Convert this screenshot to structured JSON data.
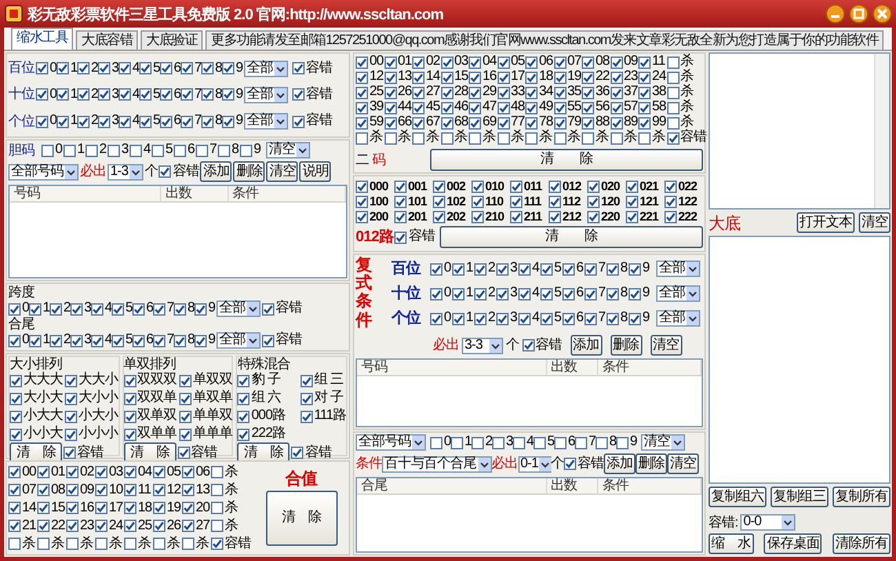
{
  "window": {
    "title": "彩无敌彩票软件三星工具免费版 2.0 官网:http://www.sscltan.com"
  },
  "tabs": [
    {
      "label": "缩水工具",
      "selected": true
    },
    {
      "label": "大底容错",
      "selected": false
    },
    {
      "label": "大底验证",
      "selected": false
    },
    {
      "label": "更多功能请发至邮箱1257251000@qq.com感谢我们官网www.sscltan.com发来文章彩无敌全新为您打造属于你的功能软件",
      "selected": false
    }
  ],
  "left": {
    "positions": [
      {
        "label": "百位",
        "digits": [
          {
            "label": "0",
            "checked": true
          },
          {
            "label": "1",
            "checked": true
          },
          {
            "label": "2",
            "checked": true
          },
          {
            "label": "3",
            "checked": true
          },
          {
            "label": "4",
            "checked": true
          },
          {
            "label": "5",
            "checked": true
          },
          {
            "label": "6",
            "checked": true
          },
          {
            "label": "7",
            "checked": true
          },
          {
            "label": "8",
            "checked": true
          },
          {
            "label": "9",
            "checked": true
          }
        ],
        "select": "全部",
        "tolerance": {
          "label": "容错",
          "checked": true
        }
      },
      {
        "label": "十位",
        "digits": [
          {
            "label": "0",
            "checked": true
          },
          {
            "label": "1",
            "checked": true
          },
          {
            "label": "2",
            "checked": true
          },
          {
            "label": "3",
            "checked": true
          },
          {
            "label": "4",
            "checked": true
          },
          {
            "label": "5",
            "checked": true
          },
          {
            "label": "6",
            "checked": true
          },
          {
            "label": "7",
            "checked": true
          },
          {
            "label": "8",
            "checked": true
          },
          {
            "label": "9",
            "checked": true
          }
        ],
        "select": "全部",
        "tolerance": {
          "label": "容错",
          "checked": true
        }
      },
      {
        "label": "个位",
        "digits": [
          {
            "label": "0",
            "checked": true
          },
          {
            "label": "1",
            "checked": true
          },
          {
            "label": "2",
            "checked": true
          },
          {
            "label": "3",
            "checked": true
          },
          {
            "label": "4",
            "checked": true
          },
          {
            "label": "5",
            "checked": true
          },
          {
            "label": "6",
            "checked": true
          },
          {
            "label": "7",
            "checked": true
          },
          {
            "label": "8",
            "checked": true
          },
          {
            "label": "9",
            "checked": true
          }
        ],
        "select": "全部",
        "tolerance": {
          "label": "容错",
          "checked": true
        }
      }
    ],
    "dan": {
      "label": "胆码",
      "digits": [
        {
          "label": "0",
          "checked": false
        },
        {
          "label": "1",
          "checked": false
        },
        {
          "label": "2",
          "checked": false
        },
        {
          "label": "3",
          "checked": false
        },
        {
          "label": "4",
          "checked": false
        },
        {
          "label": "5",
          "checked": false
        },
        {
          "label": "6",
          "checked": false
        },
        {
          "label": "7",
          "checked": false
        },
        {
          "label": "8",
          "checked": false
        },
        {
          "label": "9",
          "checked": false
        }
      ],
      "select": "清空"
    },
    "dan_filter": {
      "select": "全部号码",
      "must_label": "必出",
      "must_select": "1-3",
      "unit": "个",
      "tolerance": {
        "label": "容错",
        "checked": true
      },
      "buttons": [
        "添加",
        "删除",
        "清空",
        "说明"
      ]
    },
    "dan_list": {
      "columns": [
        "号码",
        "出数",
        "条件"
      ]
    },
    "span": {
      "label": "跨度",
      "digits": [
        {
          "label": "0",
          "checked": true
        },
        {
          "label": "1",
          "checked": true
        },
        {
          "label": "2",
          "checked": true
        },
        {
          "label": "3",
          "checked": true
        },
        {
          "label": "4",
          "checked": true
        },
        {
          "label": "5",
          "checked": true
        },
        {
          "label": "6",
          "checked": true
        },
        {
          "label": "7",
          "checked": true
        },
        {
          "label": "8",
          "checked": true
        },
        {
          "label": "9",
          "checked": true
        }
      ],
      "select": "全部",
      "tolerance": {
        "label": "容错",
        "checked": true
      }
    },
    "sum_tail": {
      "label": "合尾",
      "digits": [
        {
          "label": "0",
          "checked": true
        },
        {
          "label": "1",
          "checked": true
        },
        {
          "label": "2",
          "checked": true
        },
        {
          "label": "3",
          "checked": true
        },
        {
          "label": "4",
          "checked": true
        },
        {
          "label": "5",
          "checked": true
        },
        {
          "label": "6",
          "checked": true
        },
        {
          "label": "7",
          "checked": true
        },
        {
          "label": "8",
          "checked": true
        },
        {
          "label": "9",
          "checked": true
        }
      ],
      "select": "全部",
      "tolerance": {
        "label": "容错",
        "checked": true
      }
    },
    "groups": [
      {
        "title": "大小排列",
        "items": [
          {
            "label": "大大大",
            "checked": true
          },
          {
            "label": "大大小",
            "checked": true
          },
          {
            "label": "大小大",
            "checked": true
          },
          {
            "label": "大小小",
            "checked": true
          },
          {
            "label": "小大大",
            "checked": true
          },
          {
            "label": "小大小",
            "checked": true
          },
          {
            "label": "小小大",
            "checked": true
          },
          {
            "label": "小小小",
            "checked": true
          }
        ],
        "button": "清　除",
        "tolerance": {
          "label": "容错",
          "checked": true
        }
      },
      {
        "title": "单双排列",
        "items": [
          {
            "label": "双双双",
            "checked": true
          },
          {
            "label": "单双双",
            "checked": true
          },
          {
            "label": "双双单",
            "checked": true
          },
          {
            "label": "单双单",
            "checked": true
          },
          {
            "label": "双单双",
            "checked": true
          },
          {
            "label": "单单双",
            "checked": true
          },
          {
            "label": "双单单",
            "checked": true
          },
          {
            "label": "单单单",
            "checked": true
          }
        ],
        "button": "清　除",
        "tolerance": {
          "label": "容错",
          "checked": true
        }
      },
      {
        "title": "特殊混合",
        "items": [
          {
            "label": "豹 子",
            "checked": true
          },
          {
            "label": "组 三",
            "checked": true
          },
          {
            "label": "组 六",
            "checked": true
          },
          {
            "label": "对 子",
            "checked": true
          },
          {
            "label": "000路",
            "checked": true
          },
          {
            "label": "111路",
            "checked": true
          },
          {
            "label": "222路",
            "checked": true
          }
        ],
        "button": "清　除",
        "tolerance": {
          "label": "容错",
          "checked": true
        }
      }
    ],
    "sums": {
      "rows": [
        {
          "items": [
            {
              "label": "00",
              "checked": true
            },
            {
              "label": "01",
              "checked": true
            },
            {
              "label": "02",
              "checked": true
            },
            {
              "label": "03",
              "checked": true
            },
            {
              "label": "04",
              "checked": true
            },
            {
              "label": "05",
              "checked": true
            },
            {
              "label": "06",
              "checked": true
            }
          ],
          "kill": {
            "label": "杀",
            "checked": false
          }
        },
        {
          "items": [
            {
              "label": "07",
              "checked": true
            },
            {
              "label": "08",
              "checked": true
            },
            {
              "label": "09",
              "checked": true
            },
            {
              "label": "10",
              "checked": true
            },
            {
              "label": "11",
              "checked": true
            },
            {
              "label": "12",
              "checked": true
            },
            {
              "label": "13",
              "checked": true
            }
          ],
          "kill": {
            "label": "杀",
            "checked": false
          }
        },
        {
          "items": [
            {
              "label": "14",
              "checked": true
            },
            {
              "label": "15",
              "checked": true
            },
            {
              "label": "16",
              "checked": true
            },
            {
              "label": "17",
              "checked": true
            },
            {
              "label": "18",
              "checked": true
            },
            {
              "label": "19",
              "checked": true
            },
            {
              "label": "20",
              "checked": true
            }
          ],
          "kill": {
            "label": "杀",
            "checked": false
          }
        },
        {
          "items": [
            {
              "label": "21",
              "checked": true
            },
            {
              "label": "22",
              "checked": true
            },
            {
              "label": "23",
              "checked": true
            },
            {
              "label": "24",
              "checked": true
            },
            {
              "label": "25",
              "checked": true
            },
            {
              "label": "26",
              "checked": true
            },
            {
              "label": "27",
              "checked": true
            }
          ],
          "kill": {
            "label": "杀",
            "checked": false
          }
        }
      ],
      "kills": [
        {
          "label": "杀",
          "checked": false
        },
        {
          "label": "杀",
          "checked": false
        },
        {
          "label": "杀",
          "checked": false
        },
        {
          "label": "杀",
          "checked": false
        },
        {
          "label": "杀",
          "checked": false
        },
        {
          "label": "杀",
          "checked": false
        },
        {
          "label": "杀",
          "checked": false
        }
      ],
      "tolerance": {
        "label": "容错",
        "checked": true
      },
      "title": "合值",
      "button": "清　除"
    }
  },
  "middle": {
    "pairs": {
      "rows": [
        {
          "items": [
            {
              "label": "00",
              "checked": true
            },
            {
              "label": "01",
              "checked": true
            },
            {
              "label": "02",
              "checked": true
            },
            {
              "label": "03",
              "checked": true
            },
            {
              "label": "04",
              "checked": true
            },
            {
              "label": "05",
              "checked": true
            },
            {
              "label": "06",
              "checked": true
            },
            {
              "label": "07",
              "checked": true
            },
            {
              "label": "08",
              "checked": true
            },
            {
              "label": "09",
              "checked": true
            },
            {
              "label": "11",
              "checked": true
            }
          ],
          "kill": {
            "label": "杀",
            "checked": false
          }
        },
        {
          "items": [
            {
              "label": "12",
              "checked": true
            },
            {
              "label": "13",
              "checked": true
            },
            {
              "label": "14",
              "checked": true
            },
            {
              "label": "15",
              "checked": true
            },
            {
              "label": "16",
              "checked": true
            },
            {
              "label": "17",
              "checked": true
            },
            {
              "label": "18",
              "checked": true
            },
            {
              "label": "19",
              "checked": true
            },
            {
              "label": "22",
              "checked": true
            },
            {
              "label": "23",
              "checked": true
            },
            {
              "label": "24",
              "checked": true
            }
          ],
          "kill": {
            "label": "杀",
            "checked": false
          }
        },
        {
          "items": [
            {
              "label": "25",
              "checked": true
            },
            {
              "label": "26",
              "checked": true
            },
            {
              "label": "27",
              "checked": true
            },
            {
              "label": "28",
              "checked": true
            },
            {
              "label": "29",
              "checked": true
            },
            {
              "label": "33",
              "checked": true
            },
            {
              "label": "34",
              "checked": true
            },
            {
              "label": "35",
              "checked": true
            },
            {
              "label": "36",
              "checked": true
            },
            {
              "label": "37",
              "checked": true
            },
            {
              "label": "38",
              "checked": true
            }
          ],
          "kill": {
            "label": "杀",
            "checked": false
          }
        },
        {
          "items": [
            {
              "label": "39",
              "checked": true
            },
            {
              "label": "44",
              "checked": true
            },
            {
              "label": "45",
              "checked": true
            },
            {
              "label": "46",
              "checked": true
            },
            {
              "label": "47",
              "checked": true
            },
            {
              "label": "48",
              "checked": true
            },
            {
              "label": "49",
              "checked": true
            },
            {
              "label": "55",
              "checked": true
            },
            {
              "label": "56",
              "checked": true
            },
            {
              "label": "57",
              "checked": true
            },
            {
              "label": "58",
              "checked": true
            }
          ],
          "kill": {
            "label": "杀",
            "checked": false
          }
        },
        {
          "items": [
            {
              "label": "59",
              "checked": true
            },
            {
              "label": "66",
              "checked": true
            },
            {
              "label": "67",
              "checked": true
            },
            {
              "label": "68",
              "checked": true
            },
            {
              "label": "69",
              "checked": true
            },
            {
              "label": "77",
              "checked": true
            },
            {
              "label": "78",
              "checked": true
            },
            {
              "label": "79",
              "checked": true
            },
            {
              "label": "88",
              "checked": true
            },
            {
              "label": "89",
              "checked": true
            },
            {
              "label": "99",
              "checked": true
            }
          ],
          "kill": {
            "label": "杀",
            "checked": false
          }
        }
      ],
      "kills": [
        {
          "label": "杀",
          "checked": false
        },
        {
          "label": "杀",
          "checked": false
        },
        {
          "label": "杀",
          "checked": false
        },
        {
          "label": "杀",
          "checked": false
        },
        {
          "label": "杀",
          "checked": false
        },
        {
          "label": "杀",
          "checked": false
        },
        {
          "label": "杀",
          "checked": false
        },
        {
          "label": "杀",
          "checked": false
        },
        {
          "label": "杀",
          "checked": false
        },
        {
          "label": "杀",
          "checked": false
        },
        {
          "label": "杀",
          "checked": false
        }
      ],
      "tolerance": {
        "label": "容错",
        "checked": true
      },
      "title_parts": [
        {
          "text": "二",
          "color": "#000000"
        },
        {
          "text": "码",
          "color": "#e00000"
        }
      ],
      "button": "清　　除"
    },
    "route012": {
      "items": [
        {
          "label": "000",
          "checked": true
        },
        {
          "label": "001",
          "checked": true
        },
        {
          "label": "002",
          "checked": true
        },
        {
          "label": "010",
          "checked": true
        },
        {
          "label": "011",
          "checked": true
        },
        {
          "label": "012",
          "checked": true
        },
        {
          "label": "020",
          "checked": true
        },
        {
          "label": "021",
          "checked": true
        },
        {
          "label": "022",
          "checked": true
        },
        {
          "label": "100",
          "checked": true
        },
        {
          "label": "101",
          "checked": true
        },
        {
          "label": "102",
          "checked": true
        },
        {
          "label": "110",
          "checked": true
        },
        {
          "label": "111",
          "checked": true
        },
        {
          "label": "112",
          "checked": true
        },
        {
          "label": "120",
          "checked": true
        },
        {
          "label": "121",
          "checked": true
        },
        {
          "label": "122",
          "checked": true
        },
        {
          "label": "200",
          "checked": true
        },
        {
          "label": "201",
          "checked": true
        },
        {
          "label": "202",
          "checked": true
        },
        {
          "label": "210",
          "checked": true
        },
        {
          "label": "211",
          "checked": true
        },
        {
          "label": "212",
          "checked": true
        },
        {
          "label": "220",
          "checked": true
        },
        {
          "label": "221",
          "checked": true
        },
        {
          "label": "222",
          "checked": true
        }
      ],
      "label": "012路",
      "tolerance": {
        "label": "容错",
        "checked": true
      },
      "button": "清　　除"
    },
    "compound": {
      "title": "复式条件",
      "rows": [
        {
          "label": "百位",
          "digits": [
            {
              "label": "0",
              "checked": true
            },
            {
              "label": "1",
              "checked": true
            },
            {
              "label": "2",
              "checked": true
            },
            {
              "label": "3",
              "checked": true
            },
            {
              "label": "4",
              "checked": true
            },
            {
              "label": "5",
              "checked": true
            },
            {
              "label": "6",
              "checked": true
            },
            {
              "label": "7",
              "checked": true
            },
            {
              "label": "8",
              "checked": true
            },
            {
              "label": "9",
              "checked": true
            }
          ],
          "select": "全部"
        },
        {
          "label": "十位",
          "digits": [
            {
              "label": "0",
              "checked": true
            },
            {
              "label": "1",
              "checked": true
            },
            {
              "label": "2",
              "checked": true
            },
            {
              "label": "3",
              "checked": true
            },
            {
              "label": "4",
              "checked": true
            },
            {
              "label": "5",
              "checked": true
            },
            {
              "label": "6",
              "checked": true
            },
            {
              "label": "7",
              "checked": true
            },
            {
              "label": "8",
              "checked": true
            },
            {
              "label": "9",
              "checked": true
            }
          ],
          "select": "全部"
        },
        {
          "label": "个位",
          "digits": [
            {
              "label": "0",
              "checked": true
            },
            {
              "label": "1",
              "checked": true
            },
            {
              "label": "2",
              "checked": true
            },
            {
              "label": "3",
              "checked": true
            },
            {
              "label": "4",
              "checked": true
            },
            {
              "label": "5",
              "checked": true
            },
            {
              "label": "6",
              "checked": true
            },
            {
              "label": "7",
              "checked": true
            },
            {
              "label": "8",
              "checked": true
            },
            {
              "label": "9",
              "checked": true
            }
          ],
          "select": "全部"
        }
      ],
      "must_label": "必出",
      "must_select": "3-3",
      "unit": "个",
      "tolerance": {
        "label": "容错",
        "checked": true
      },
      "buttons": [
        "添加",
        "删除",
        "清空"
      ],
      "list": {
        "columns": [
          "号码",
          "出数",
          "条件"
        ]
      }
    },
    "tail": {
      "select": "全部号码",
      "digits": [
        {
          "label": "0",
          "checked": false
        },
        {
          "label": "1",
          "checked": false
        },
        {
          "label": "2",
          "checked": false
        },
        {
          "label": "3",
          "checked": false
        },
        {
          "label": "4",
          "checked": false
        },
        {
          "label": "5",
          "checked": false
        },
        {
          "label": "6",
          "checked": false
        },
        {
          "label": "7",
          "checked": false
        },
        {
          "label": "8",
          "checked": false
        },
        {
          "label": "9",
          "checked": false
        }
      ],
      "clear_select": "清空",
      "cond_label": "条件",
      "cond_select": "百十与百个合尾",
      "must_label": "必出",
      "must_select": "0-1",
      "unit": "个",
      "tolerance": {
        "label": "容错",
        "checked": true
      },
      "buttons": [
        "添加",
        "删除",
        "清空"
      ],
      "list": {
        "columns": [
          "合尾",
          "出数",
          "条件"
        ]
      }
    }
  },
  "right": {
    "base_label": "大底",
    "buttons": [
      "打开文本",
      "清空"
    ],
    "copy_buttons": [
      "复制组六",
      "复制组三",
      "复制所有"
    ],
    "tolerance_label": "容错:",
    "tolerance_select": "0-0",
    "actions": [
      "缩　水",
      "保存桌面",
      "清除所有"
    ]
  }
}
